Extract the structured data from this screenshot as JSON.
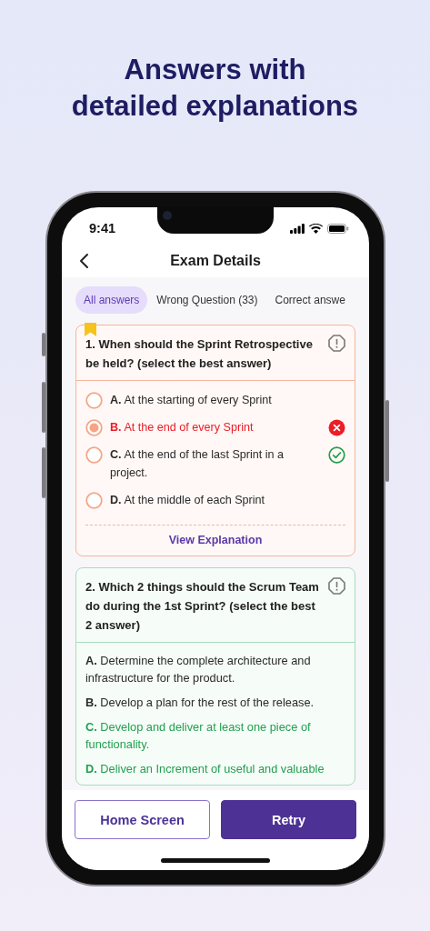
{
  "headline": "Answers with\ndetailed explanations",
  "status_bar": {
    "time": "9:41"
  },
  "header": {
    "title": "Exam Details"
  },
  "tabs": [
    {
      "label": "All answers",
      "selected": true
    },
    {
      "label": "Wrong Question (33)",
      "selected": false
    },
    {
      "label": "Correct answe",
      "selected": false
    }
  ],
  "questions": [
    {
      "kind": "choice",
      "answered_correctly": false,
      "bookmarked": true,
      "text": "1. When should the Sprint Retrospective be held? (select the best answer)",
      "options": [
        {
          "text": "**A.** At the starting of every Sprint",
          "selected": false,
          "correct": false
        },
        {
          "text": "**B.** At the end of every Sprint",
          "selected": true,
          "correct": false
        },
        {
          "text": "**C.** At the end of the last Sprint in a project.",
          "selected": false,
          "correct": true
        },
        {
          "text": "**D.** At the middle of each Sprint",
          "selected": false,
          "correct": false
        }
      ],
      "link": "View Explanation"
    },
    {
      "kind": "list",
      "answered_correctly": true,
      "bookmarked": false,
      "text": "2. Which 2 things should the Scrum Team do during the 1st Sprint? (select the best 2 answer)",
      "options": [
        {
          "text": "**A.** Determine the complete architecture and infrastructure for the product.",
          "correct": false
        },
        {
          "text": "**B.** Develop a plan for the rest of the release.",
          "correct": false
        },
        {
          "text": "**C.** Develop and deliver at least one piece of functionality.",
          "correct": true
        },
        {
          "text": "**D.** Deliver an Increment of useful and valuable",
          "correct": true
        }
      ]
    }
  ],
  "buttons": [
    {
      "label": "Home Screen",
      "kind": "outline"
    },
    {
      "label": "Retry",
      "kind": "filled"
    }
  ]
}
